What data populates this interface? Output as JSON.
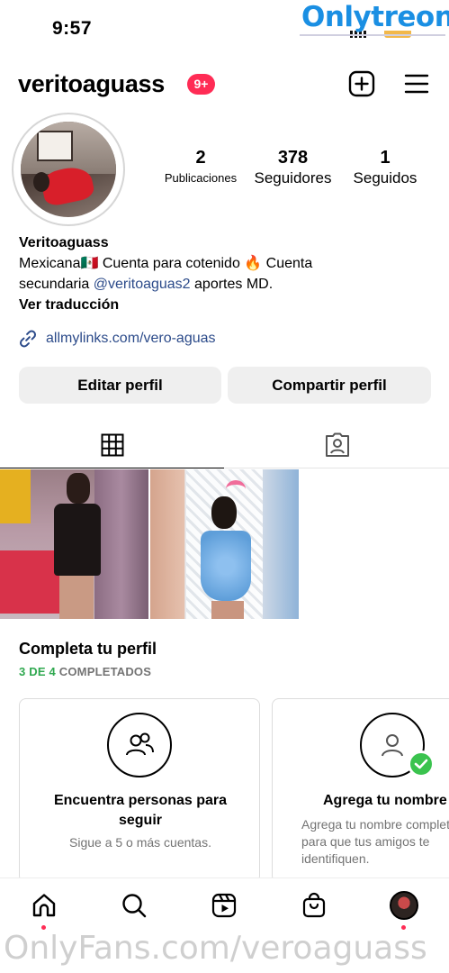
{
  "status_bar": {
    "time": "9:57"
  },
  "watermark_top": {
    "part1": "Only",
    "part2": "treon"
  },
  "header": {
    "username": "veritoaguass",
    "notifications_badge": "9+"
  },
  "stats": [
    {
      "value": "2",
      "label": "Publicaciones"
    },
    {
      "value": "378",
      "label": "Seguidores"
    },
    {
      "value": "1",
      "label": "Seguidos"
    }
  ],
  "bio": {
    "name": "Veritoaguass",
    "line1": "Mexicana🇲🇽 Cuenta para cotenido 🔥 Cuenta",
    "line2_pre": "secundaria ",
    "mention": "@veritoaguas2",
    "line2_post": " aportes MD.",
    "translate": "Ver traducción",
    "link": "allmylinks.com/vero-aguas"
  },
  "buttons": {
    "edit": "Editar perfil",
    "share": "Compartir perfil"
  },
  "complete_profile": {
    "title": "Completa tu perfil",
    "progress_done": "3 DE 4",
    "progress_rest": " COMPLETADOS",
    "cards": [
      {
        "title": "Encuentra personas para seguir",
        "desc": "Sigue a 5 o más cuentas."
      },
      {
        "title": "Agrega tu nombre",
        "desc": "Agrega tu nombre completo para que tus amigos te identifiquen."
      }
    ]
  },
  "watermark_bottom": "OnlyFans.com/veroaguass",
  "colors": {
    "badge": "#ff2c55",
    "link": "#2c4b8a",
    "progress": "#2fa84f",
    "button_bg": "#efefef"
  }
}
